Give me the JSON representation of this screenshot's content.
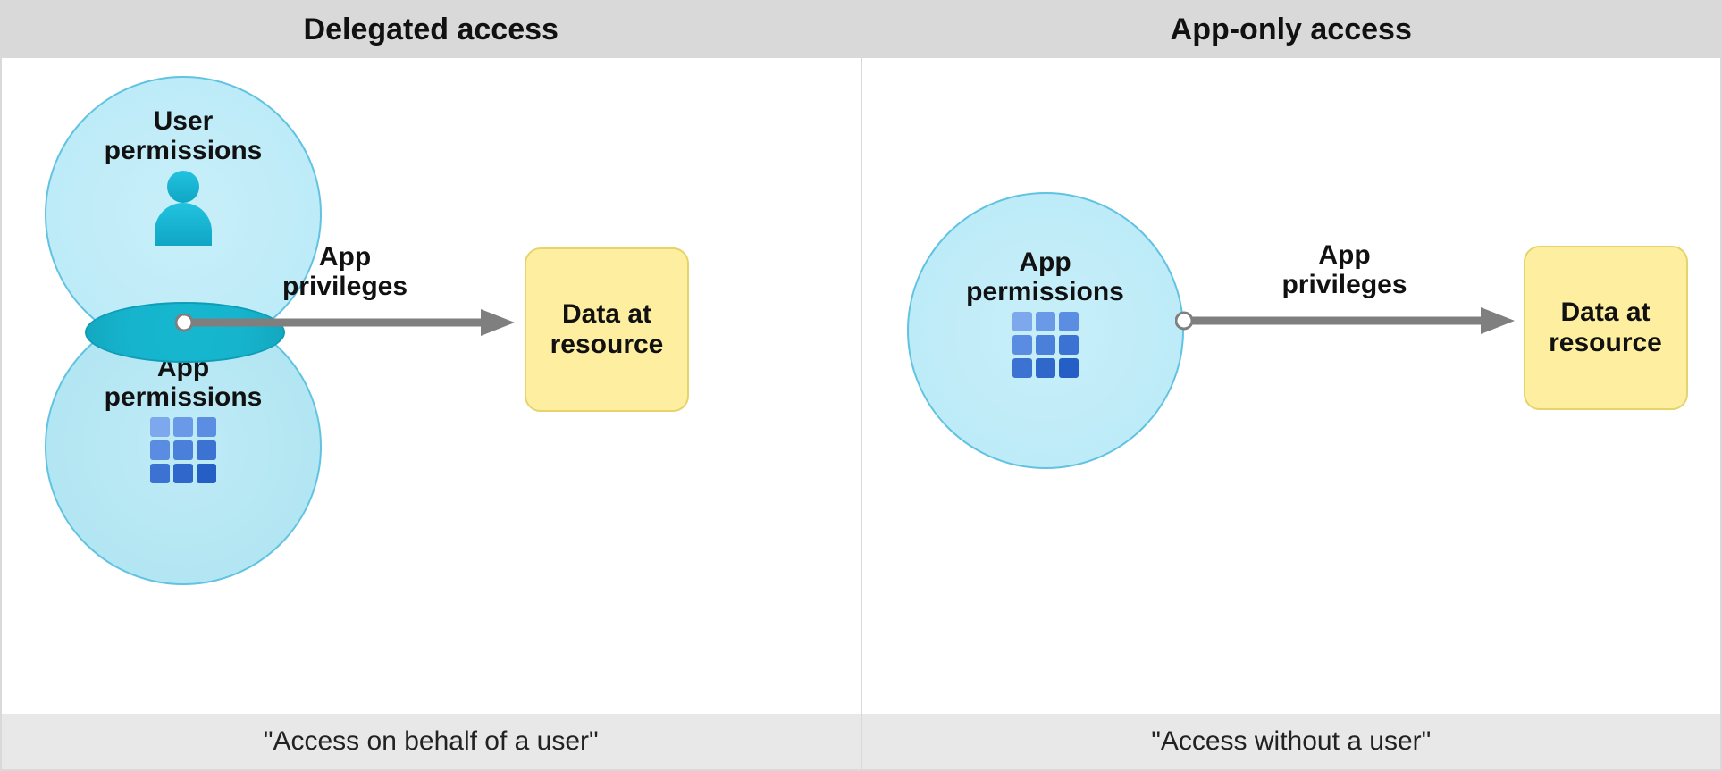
{
  "panels": {
    "delegated": {
      "title": "Delegated access",
      "caption": "\"Access on behalf of a user\""
    },
    "appOnly": {
      "title": "App-only access",
      "caption": "\"Access without a user\""
    }
  },
  "labels": {
    "userPermissions": "User\npermissions",
    "appPermissions": "App\npermissions",
    "appPrivileges": "App\nprivileges",
    "dataAtResource": "Data at\nresource"
  },
  "icons": {
    "user": "user-icon",
    "appGrid": "app-grid-icon"
  },
  "colors": {
    "headerBg": "#d9d9d9",
    "footerBg": "#e8e8e8",
    "circleTopFill": "#bdebf8",
    "circleBottomFill": "#b2e6f2",
    "circleStroke": "#61c3e1",
    "arrow": "#7f7f7f",
    "resourceFill": "#feefa0",
    "resourceStroke": "#e6d36b",
    "gridColors": [
      "#7ea8ed",
      "#6a99e7",
      "#5b8de3",
      "#5a8ce1",
      "#4a7fda",
      "#3c73d3",
      "#3c73d3",
      "#2f67cb",
      "#255ec4"
    ]
  }
}
